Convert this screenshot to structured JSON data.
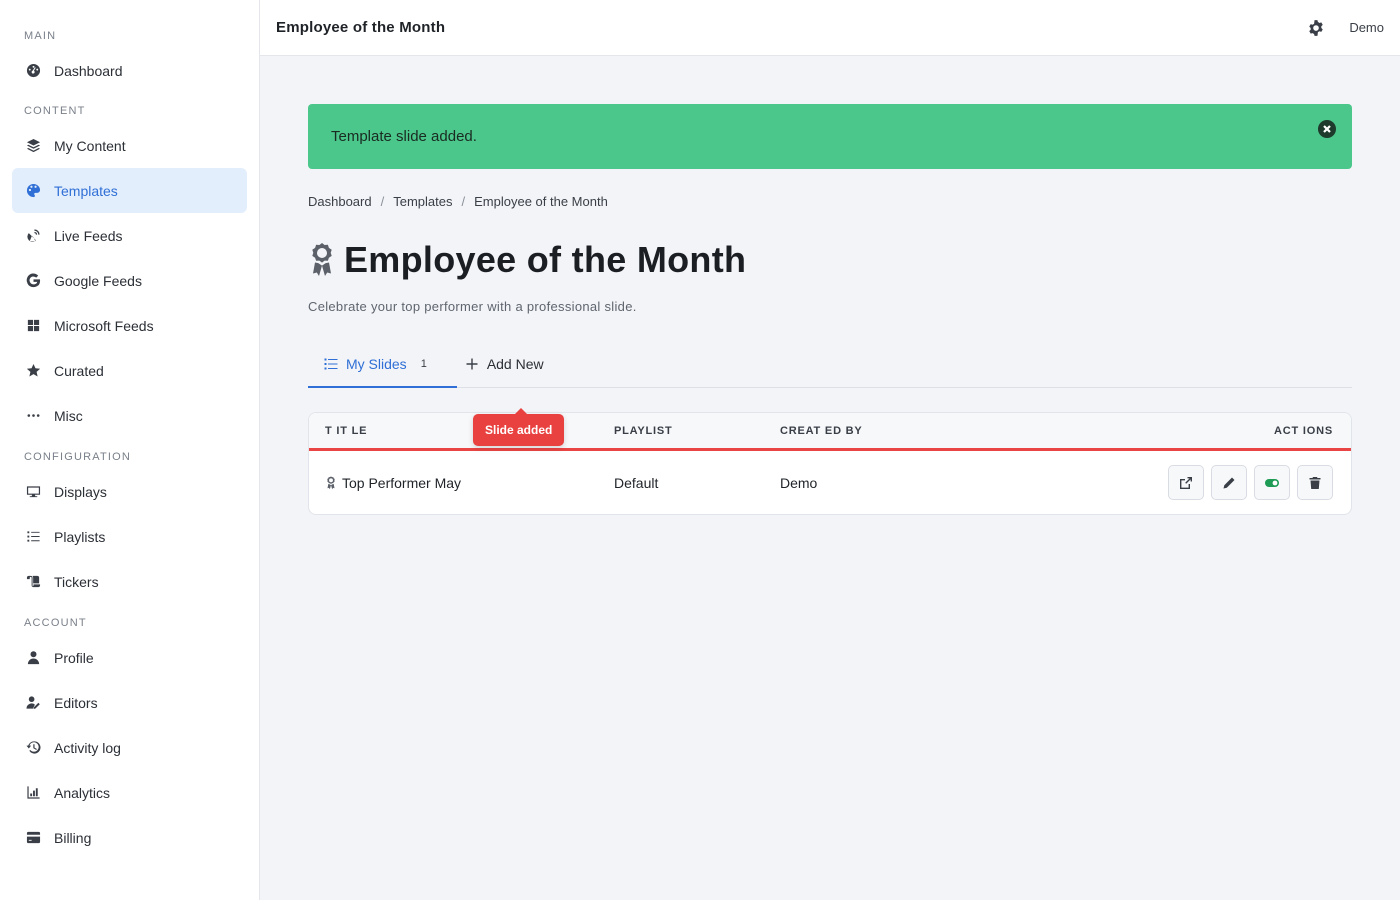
{
  "sidebar": {
    "sections": [
      {
        "label": "MAIN",
        "items": [
          {
            "label": "Dashboard",
            "icon": "dashboard-icon"
          }
        ]
      },
      {
        "label": "CONTENT",
        "items": [
          {
            "label": "My Content",
            "icon": "layers-icon"
          },
          {
            "label": "Templates",
            "icon": "palette-icon",
            "active": true
          },
          {
            "label": "Live Feeds",
            "icon": "satellite-dish-icon"
          },
          {
            "label": "Google Feeds",
            "icon": "google-icon"
          },
          {
            "label": "Microsoft Feeds",
            "icon": "windows-icon"
          },
          {
            "label": "Curated",
            "icon": "star-icon"
          },
          {
            "label": "Misc",
            "icon": "ellipsis-icon"
          }
        ]
      },
      {
        "label": "CONFIGURATION",
        "items": [
          {
            "label": "Displays",
            "icon": "monitor-icon"
          },
          {
            "label": "Playlists",
            "icon": "list-icon"
          },
          {
            "label": "Tickers",
            "icon": "scroll-icon"
          }
        ]
      },
      {
        "label": "ACCOUNT",
        "items": [
          {
            "label": "Profile",
            "icon": "user-icon"
          },
          {
            "label": "Editors",
            "icon": "user-edit-icon"
          },
          {
            "label": "Activity log",
            "icon": "history-icon"
          },
          {
            "label": "Analytics",
            "icon": "chart-icon"
          },
          {
            "label": "Billing",
            "icon": "credit-card-icon"
          }
        ]
      }
    ]
  },
  "header": {
    "title": "Employee of the Month",
    "user": "Demo"
  },
  "alert": {
    "message": "Template slide added."
  },
  "breadcrumb": {
    "items": [
      "Dashboard",
      "Templates",
      "Employee of the Month"
    ]
  },
  "page": {
    "title": "Employee of the Month",
    "subtitle": "Celebrate your top performer with a professional slide."
  },
  "tabs": {
    "my_slides": {
      "label": "My Slides",
      "count": "1"
    },
    "add_new": {
      "label": "Add New"
    }
  },
  "table": {
    "headers": {
      "title": "T IT LE",
      "playlist": "PLAYLIST",
      "created_by": "CREAT ED BY",
      "actions": "ACT IONS"
    },
    "rows": [
      {
        "title": "Top Performer May",
        "playlist": "Default",
        "created_by": "Demo"
      }
    ]
  },
  "tooltip": {
    "text": "Slide added"
  },
  "colors": {
    "accent": "#2f6fd6",
    "success": "#4bc78b",
    "danger": "#e8413f",
    "toggle_on": "#1e9b55"
  }
}
